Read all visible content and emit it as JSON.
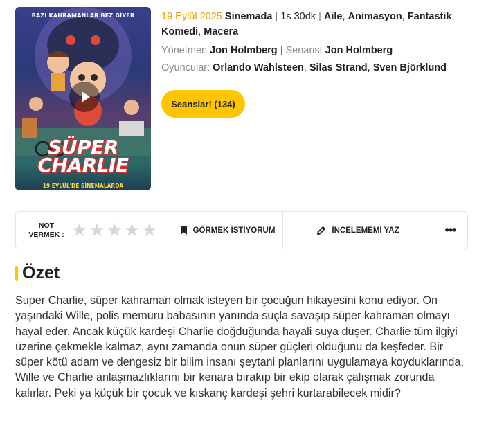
{
  "poster": {
    "tagline": "BAZI KAHRAMANLAR BEZ GİYER",
    "title": "SÜPER CHARLIE",
    "release_banner": "19 EYLÜL'DE SİNEMALARDA"
  },
  "movie": {
    "release_date": "19 Eylül 2025",
    "status": "Sinemada",
    "duration": "1s 30dk",
    "genres": [
      "Aile",
      "Animasyon",
      "Fantastik",
      "Komedi",
      "Macera"
    ],
    "director_label": "Yönetmen",
    "director": "Jon Holmberg",
    "writer_label": "Senarist",
    "writer": "Jon Holmberg",
    "cast_label": "Oyuncular:",
    "cast": [
      "Orlando Wahlsteen",
      "Silas Strand",
      "Sven Björklund"
    ]
  },
  "sessions_button": "Seanslar! (134)",
  "actions": {
    "rate_label_line1": "NOT",
    "rate_label_line2": "VERMEK :",
    "star_count": 5,
    "watchlist_label": "GÖRMEK İSTİYORUM",
    "review_label": "İNCELEMEMİ YAZ",
    "more_label": "•••"
  },
  "summary": {
    "heading": "Özet",
    "text": "Super Charlie, süper kahraman olmak isteyen bir çocuğun hikayesini konu ediyor. On yaşındaki Wille, polis memuru babasının yanında suçla savaşıp süper kahraman olmayı hayal eder. Ancak küçük kardeşi Charlie doğduğunda hayali suya düşer. Charlie tüm ilgiyi üzerine çekmekle kalmaz, aynı zamanda onun süper güçleri olduğunu da keşfeder. Bir süper kötü adam ve dengesiz bir bilim insanı şeytani planlarını uygulamaya koyduklarında, Wille ve Charlie anlaşmazlıklarını bir kenara bırakıp bir ekip olarak çalışmak zorunda kalırlar. Peki ya küçük bir çocuk ve kıskanç kardeşi şehri kurtarabilecek midir?"
  },
  "colors": {
    "accent": "#ffc600",
    "date": "#e3a008",
    "muted": "#8a8a8a",
    "star_empty": "#d6d6d6"
  }
}
